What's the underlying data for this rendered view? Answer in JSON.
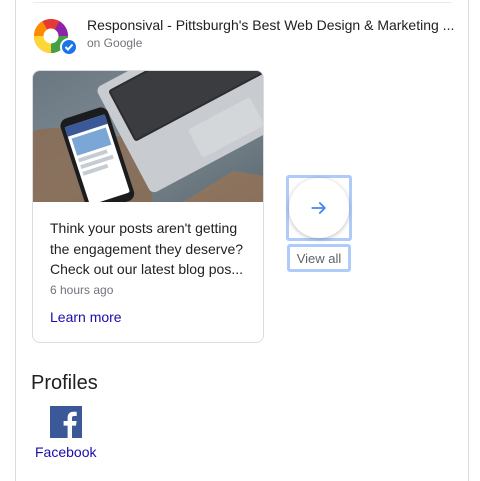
{
  "business": {
    "name": "Responsival - Pittsburgh's Best Web Design & Marketing ...",
    "source": "on Google"
  },
  "post": {
    "text": "Think your posts aren't getting the engagement they deserve? Check out our latest blog pos...",
    "time": "6 hours ago",
    "link_label": "Learn more"
  },
  "navigation": {
    "view_all_label": "View all"
  },
  "profiles": {
    "heading": "Profiles",
    "items": [
      {
        "label": "Facebook",
        "icon": "facebook-icon"
      }
    ]
  },
  "colors": {
    "link": "#1a0dab",
    "focus_ring": "#aecbfa",
    "arrow": "#4285f4",
    "facebook": "#3b5998"
  }
}
